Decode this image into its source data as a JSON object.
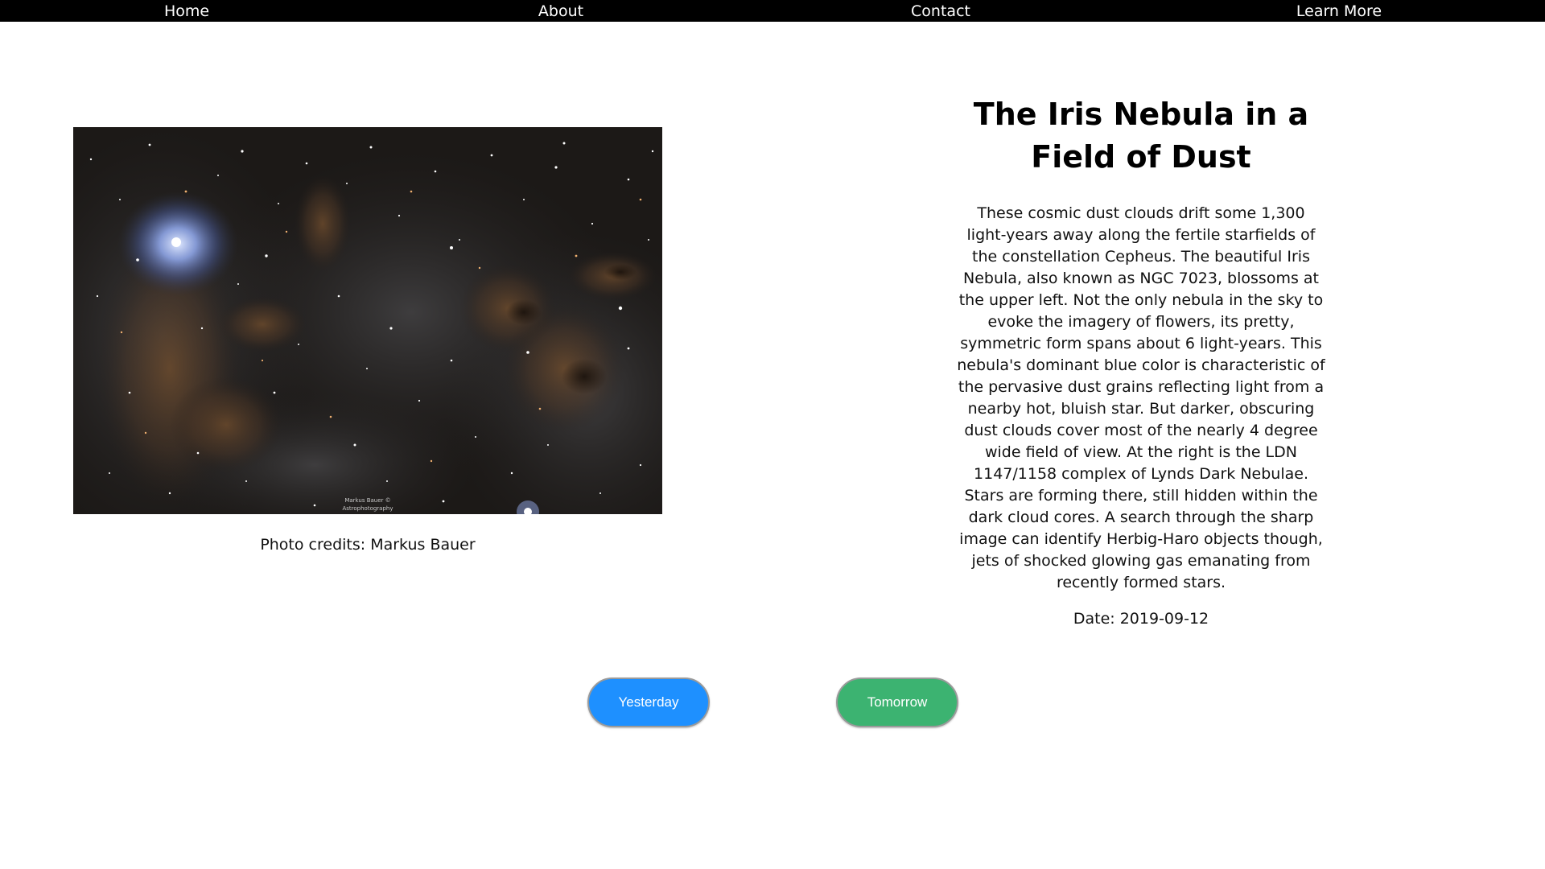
{
  "nav": {
    "items": [
      "Home",
      "About",
      "Contact",
      "Learn More"
    ]
  },
  "photo": {
    "alt": "The Iris Nebula in a Field of Dust",
    "watermark_line1": "Markus Bauer ©",
    "watermark_line2": "Astrophotography",
    "credit": "Photo credits: Markus Bauer"
  },
  "article": {
    "title": "The Iris Nebula in a Field of Dust",
    "description": "These cosmic dust clouds drift some 1,300 light-years away along the fertile starfields of the constellation Cepheus. The beautiful Iris Nebula, also known as NGC 7023, blossoms at the upper left. Not the only nebula in the sky to evoke the imagery of flowers, its pretty, symmetric form spans about 6 light-years. This nebula's dominant blue color is characteristic of the pervasive dust grains reflecting light from a nearby hot, bluish star. But darker, obscuring dust clouds cover most of the nearly 4 degree wide field of view. At the right is the LDN 1147/1158 complex of Lynds Dark Nebulae. Stars are forming there, still hidden within the dark cloud cores. A search through the sharp image can identify Herbig-Haro objects though, jets of shocked glowing gas emanating from recently formed stars.",
    "date_label": "Date:",
    "date": "2019-09-12"
  },
  "buttons": {
    "yesterday": "Yesterday",
    "tomorrow": "Tomorrow"
  },
  "colors": {
    "navbar": "#000000",
    "yesterday": "#1e90ff",
    "tomorrow": "#3cb371"
  }
}
